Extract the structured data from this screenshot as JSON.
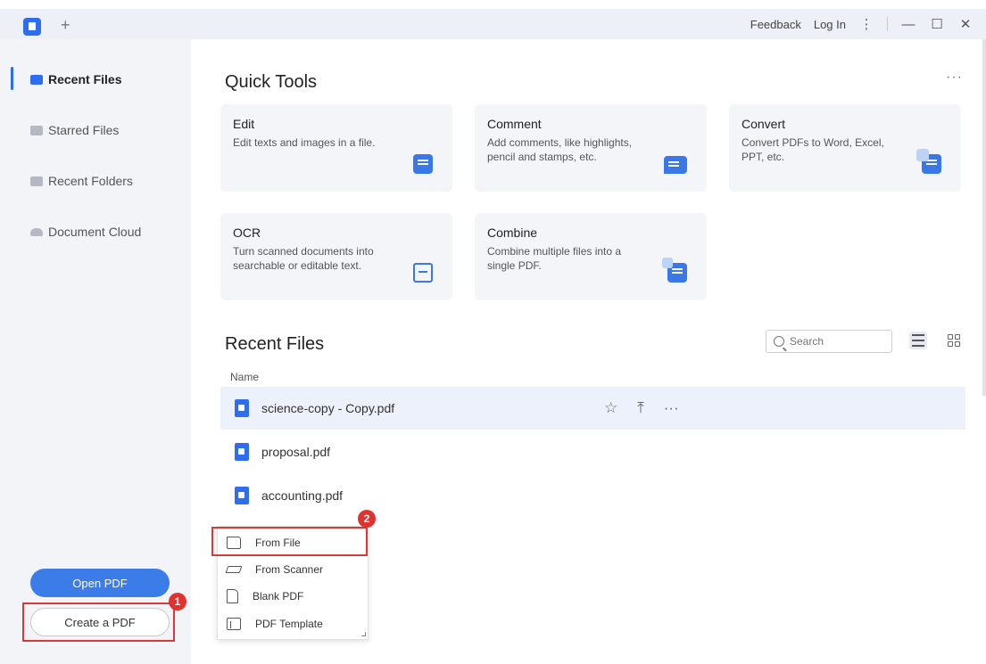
{
  "titlebar": {
    "new_tab": "+",
    "feedback": "Feedback",
    "login": "Log In",
    "menu": "⋮",
    "minimize": "—",
    "maximize": "☐",
    "close": "✕"
  },
  "sidebar": {
    "items": [
      {
        "label": "Recent Files",
        "icon": "recent-files-icon"
      },
      {
        "label": "Starred Files",
        "icon": "starred-files-icon"
      },
      {
        "label": "Recent Folders",
        "icon": "folder-icon"
      },
      {
        "label": "Document Cloud",
        "icon": "cloud-icon"
      }
    ],
    "open_pdf": "Open PDF",
    "create_pdf": "Create a PDF",
    "badge_1": "1"
  },
  "quick_tools": {
    "title": "Quick Tools",
    "more": "···",
    "cards": [
      {
        "title": "Edit",
        "desc": "Edit texts and images in a file.",
        "icon": "edit-doc-icon"
      },
      {
        "title": "Comment",
        "desc": "Add comments, like highlights, pencil and stamps, etc.",
        "icon": "comment-icon"
      },
      {
        "title": "Convert",
        "desc": "Convert PDFs to Word, Excel, PPT, etc.",
        "icon": "convert-icon"
      },
      {
        "title": "OCR",
        "desc": "Turn scanned documents into searchable or editable text.",
        "icon": "ocr-icon"
      },
      {
        "title": "Combine",
        "desc": "Combine multiple files into a single PDF.",
        "icon": "combine-icon"
      }
    ]
  },
  "recent": {
    "title": "Recent Files",
    "search_placeholder": "Search",
    "column_name": "Name",
    "files": [
      {
        "name": "science-copy - Copy.pdf"
      },
      {
        "name": "proposal.pdf"
      },
      {
        "name": "accounting.pdf"
      }
    ],
    "row_actions": {
      "star": "☆",
      "pin": "⤒",
      "more": "···"
    }
  },
  "create_menu": {
    "items": [
      {
        "label": "From File",
        "icon": "folder-icon"
      },
      {
        "label": "From Scanner",
        "icon": "scanner-icon"
      },
      {
        "label": "Blank PDF",
        "icon": "blank-page-icon"
      },
      {
        "label": "PDF Template",
        "icon": "template-icon"
      }
    ],
    "badge_2": "2"
  },
  "colors": {
    "accent": "#2f6df0",
    "highlight": "#d63a3a"
  }
}
